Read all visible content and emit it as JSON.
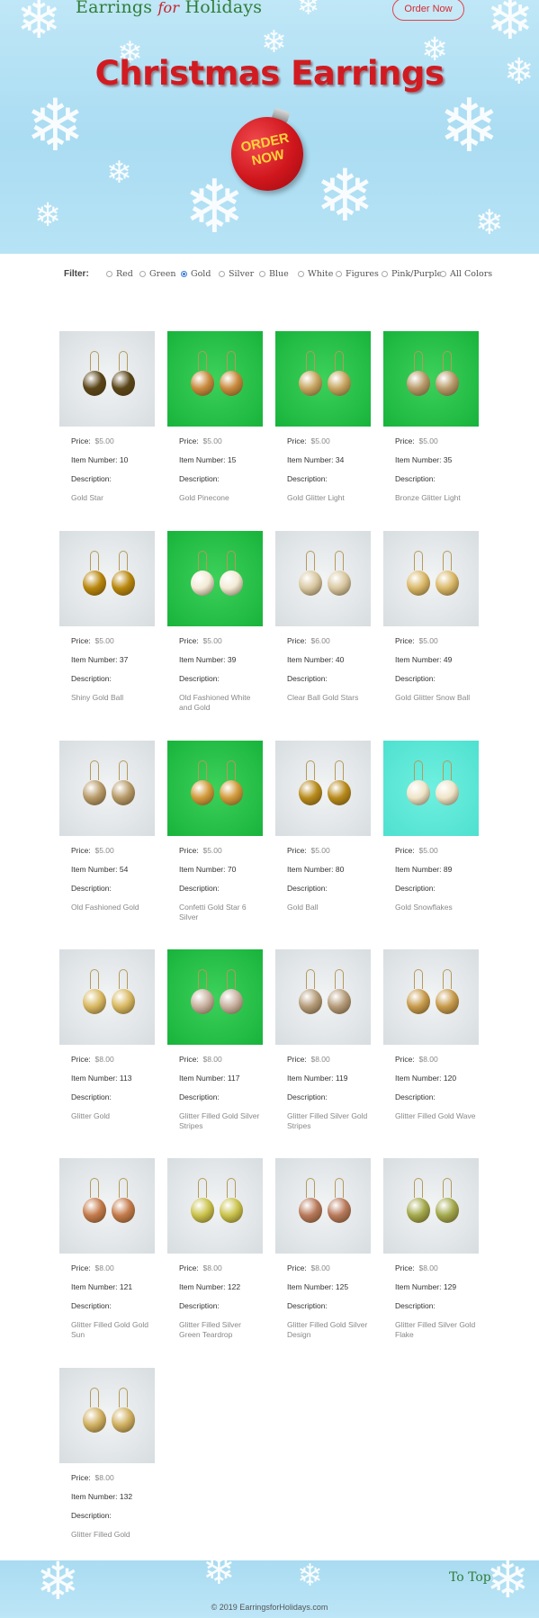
{
  "header": {
    "logo_part1": "Earrings ",
    "logo_for": "for",
    "logo_part2": " Holidays",
    "order_button": "Order Now",
    "title": "Christmas Earrings",
    "ornament_line1": "ORDER",
    "ornament_line2": "NOW"
  },
  "filter": {
    "label": "Filter:",
    "options": [
      {
        "label": "Red",
        "checked": false
      },
      {
        "label": "Green",
        "checked": false
      },
      {
        "label": "Gold",
        "checked": true
      },
      {
        "label": "Silver",
        "checked": false
      },
      {
        "label": "Blue",
        "checked": false
      },
      {
        "label": "White",
        "checked": false
      },
      {
        "label": "Figures",
        "checked": false
      },
      {
        "label": "Pink/Purple",
        "checked": false
      },
      {
        "label": "All Colors",
        "checked": false
      }
    ]
  },
  "labels": {
    "price": "Price:",
    "item_number": "Item Number:",
    "description": "Description:"
  },
  "products": [
    {
      "price": "$5.00",
      "item": "10",
      "desc": "Gold Star",
      "bg": "white",
      "color": "#5a4518"
    },
    {
      "price": "$5.00",
      "item": "15",
      "desc": "Gold Pinecone",
      "bg": "green",
      "color": "#c98a3c"
    },
    {
      "price": "$5.00",
      "item": "34",
      "desc": "Gold Glitter Light",
      "bg": "green",
      "color": "#c7a560"
    },
    {
      "price": "$5.00",
      "item": "35",
      "desc": "Bronze Glitter Light",
      "bg": "green",
      "color": "#b89a6a"
    },
    {
      "price": "$5.00",
      "item": "37",
      "desc": "Shiny Gold Ball",
      "bg": "white",
      "color": "#b8860b"
    },
    {
      "price": "$5.00",
      "item": "39",
      "desc": "Old Fashioned White and Gold",
      "bg": "green",
      "color": "#f3ead5"
    },
    {
      "price": "$6.00",
      "item": "40",
      "desc": "Clear Ball Gold Stars",
      "bg": "white",
      "color": "#d8c7a0"
    },
    {
      "price": "$5.00",
      "item": "49",
      "desc": "Gold Glitter Snow Ball",
      "bg": "white",
      "color": "#d9b766"
    },
    {
      "price": "$5.00",
      "item": "54",
      "desc": "Old Fashioned Gold",
      "bg": "white",
      "color": "#b79a68"
    },
    {
      "price": "$5.00",
      "item": "70",
      "desc": "Confetti Gold Star 6 Silver",
      "bg": "green",
      "color": "#d29a3a"
    },
    {
      "price": "$5.00",
      "item": "80",
      "desc": "Gold Ball",
      "bg": "white",
      "color": "#b88a1a"
    },
    {
      "price": "$5.00",
      "item": "89",
      "desc": "Gold Snowflakes",
      "bg": "teal",
      "color": "#efe4c8"
    },
    {
      "price": "$8.00",
      "item": "113",
      "desc": "Glitter Gold",
      "bg": "white",
      "color": "#d8b861"
    },
    {
      "price": "$8.00",
      "item": "117",
      "desc": "Glitter Filled Gold Silver Stripes",
      "bg": "green",
      "color": "#c9b2a0"
    },
    {
      "price": "$8.00",
      "item": "119",
      "desc": "Glitter Filled Silver Gold Stripes",
      "bg": "white",
      "color": "#b49a78"
    },
    {
      "price": "$8.00",
      "item": "120",
      "desc": "Glitter Filled Gold Wave",
      "bg": "white",
      "color": "#c79a4a"
    },
    {
      "price": "$8.00",
      "item": "121",
      "desc": "Glitter Filled Gold Gold Sun",
      "bg": "white",
      "color": "#c47a4a"
    },
    {
      "price": "$8.00",
      "item": "122",
      "desc": "Glitter Filled Silver Green Teardrop",
      "bg": "white",
      "color": "#c9c24a"
    },
    {
      "price": "$8.00",
      "item": "125",
      "desc": "Glitter Filled Gold Silver Design",
      "bg": "white",
      "color": "#b8785a"
    },
    {
      "price": "$8.00",
      "item": "129",
      "desc": "Glitter Filled Silver Gold Flake",
      "bg": "white",
      "color": "#a2a84a"
    },
    {
      "price": "$8.00",
      "item": "132",
      "desc": "Glitter Filled Gold",
      "bg": "white",
      "color": "#d0b060"
    }
  ],
  "footer": {
    "to_top": "To Top",
    "copyright": "© 2019 EarringsforHolidays.com"
  }
}
